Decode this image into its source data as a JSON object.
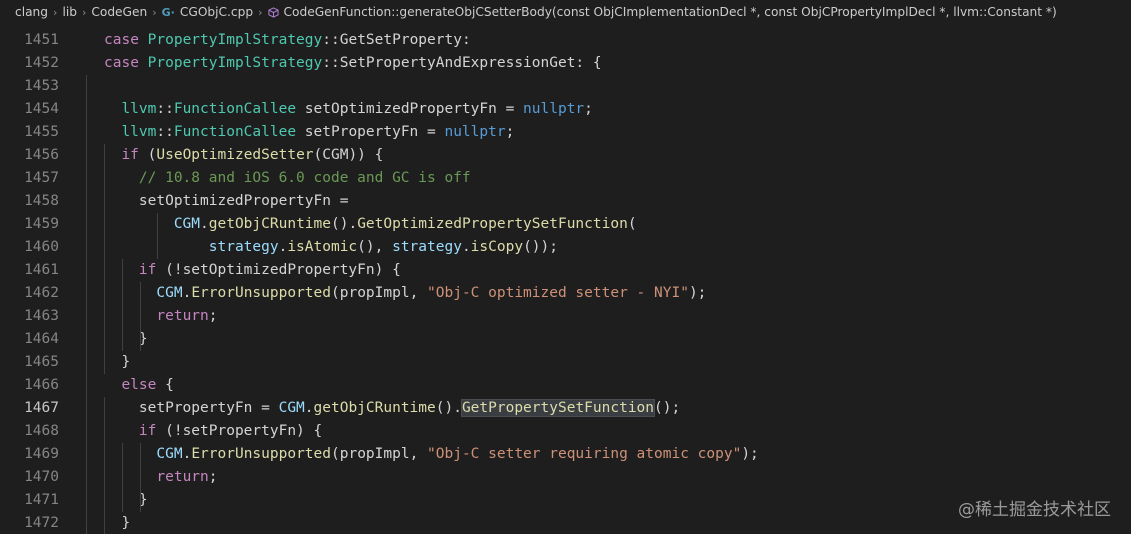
{
  "breadcrumb": {
    "items": [
      "clang",
      "lib",
      "CodeGen"
    ],
    "file": "CGObjC.cpp",
    "file_icon": "cpp-file-icon",
    "symbol": "CodeGenFunction::generateObjCSetterBody(const ObjCImplementationDecl *, const ObjCPropertyImplDecl *, llvm::Constant *)",
    "symbol_icon": "method-cube-icon"
  },
  "editor": {
    "active_line": "1467",
    "lines": [
      {
        "num": "1451",
        "tokens": [
          [
            "ctl",
            "case "
          ],
          [
            "ty",
            "PropertyImplStrategy"
          ],
          [
            "pl",
            "::"
          ],
          [
            "pl",
            "GetSetProperty:"
          ]
        ]
      },
      {
        "num": "1452",
        "tokens": [
          [
            "ctl",
            "case "
          ],
          [
            "ty",
            "PropertyImplStrategy"
          ],
          [
            "pl",
            "::"
          ],
          [
            "pl",
            "SetPropertyAndExpressionGet: {"
          ]
        ]
      },
      {
        "num": "1453",
        "tokens": []
      },
      {
        "num": "1454",
        "tokens": [
          [
            "ty",
            "llvm"
          ],
          [
            "pl",
            "::"
          ],
          [
            "ty",
            "FunctionCallee"
          ],
          [
            "pl",
            " setOptimizedPropertyFn = "
          ],
          [
            "kw",
            "nullptr"
          ],
          [
            "pl",
            ";"
          ]
        ]
      },
      {
        "num": "1455",
        "tokens": [
          [
            "ty",
            "llvm"
          ],
          [
            "pl",
            "::"
          ],
          [
            "ty",
            "FunctionCallee"
          ],
          [
            "pl",
            " setPropertyFn = "
          ],
          [
            "kw",
            "nullptr"
          ],
          [
            "pl",
            ";"
          ]
        ]
      },
      {
        "num": "1456",
        "tokens": [
          [
            "ctl",
            "if "
          ],
          [
            "pl",
            "("
          ],
          [
            "fn",
            "UseOptimizedSetter"
          ],
          [
            "pl",
            "(CGM)) {"
          ]
        ]
      },
      {
        "num": "1457",
        "tokens": [
          [
            "com",
            "// 10.8 and iOS 6.0 code and GC is off"
          ]
        ]
      },
      {
        "num": "1458",
        "tokens": [
          [
            "pl",
            "setOptimizedPropertyFn ="
          ]
        ]
      },
      {
        "num": "1459",
        "tokens": [
          [
            "var",
            "CGM"
          ],
          [
            "pl",
            "."
          ],
          [
            "fn",
            "getObjCRuntime"
          ],
          [
            "pl",
            "()."
          ],
          [
            "fn",
            "GetOptimizedPropertySetFunction"
          ],
          [
            "pl",
            "("
          ]
        ]
      },
      {
        "num": "1460",
        "tokens": [
          [
            "var",
            "strategy"
          ],
          [
            "pl",
            "."
          ],
          [
            "fn",
            "isAtomic"
          ],
          [
            "pl",
            "(), "
          ],
          [
            "var",
            "strategy"
          ],
          [
            "pl",
            "."
          ],
          [
            "fn",
            "isCopy"
          ],
          [
            "pl",
            "());"
          ]
        ]
      },
      {
        "num": "1461",
        "tokens": [
          [
            "ctl",
            "if "
          ],
          [
            "pl",
            "(!setOptimizedPropertyFn) {"
          ]
        ]
      },
      {
        "num": "1462",
        "tokens": [
          [
            "var",
            "CGM"
          ],
          [
            "pl",
            "."
          ],
          [
            "fn",
            "ErrorUnsupported"
          ],
          [
            "pl",
            "(propImpl, "
          ],
          [
            "str",
            "\"Obj-C optimized setter - NYI\""
          ],
          [
            "pl",
            ");"
          ]
        ]
      },
      {
        "num": "1463",
        "tokens": [
          [
            "ctl",
            "return"
          ],
          [
            "pl",
            ";"
          ]
        ]
      },
      {
        "num": "1464",
        "tokens": [
          [
            "pl",
            "}"
          ]
        ]
      },
      {
        "num": "1465",
        "tokens": [
          [
            "pl",
            "}"
          ]
        ]
      },
      {
        "num": "1466",
        "tokens": [
          [
            "ctl",
            "else "
          ],
          [
            "pl",
            "{"
          ]
        ]
      },
      {
        "num": "1467",
        "tokens": [
          [
            "pl",
            "setPropertyFn = "
          ],
          [
            "var",
            "CGM"
          ],
          [
            "pl",
            "."
          ],
          [
            "fn",
            "getObjCRuntime"
          ],
          [
            "pl",
            "()."
          ],
          [
            "fn",
            "GetPropertySetFunction"
          ],
          [
            "pl",
            "();"
          ]
        ]
      },
      {
        "num": "1468",
        "tokens": [
          [
            "ctl",
            "if "
          ],
          [
            "pl",
            "(!setPropertyFn) {"
          ]
        ]
      },
      {
        "num": "1469",
        "tokens": [
          [
            "var",
            "CGM"
          ],
          [
            "pl",
            "."
          ],
          [
            "fn",
            "ErrorUnsupported"
          ],
          [
            "pl",
            "(propImpl, "
          ],
          [
            "str",
            "\"Obj-C setter requiring atomic copy\""
          ],
          [
            "pl",
            ");"
          ]
        ]
      },
      {
        "num": "1470",
        "tokens": [
          [
            "ctl",
            "return"
          ],
          [
            "pl",
            ";"
          ]
        ]
      },
      {
        "num": "1471",
        "tokens": [
          [
            "pl",
            "}"
          ]
        ]
      },
      {
        "num": "1472",
        "tokens": [
          [
            "pl",
            "}"
          ]
        ]
      }
    ]
  },
  "watermark": "@稀土掘金技术社区"
}
